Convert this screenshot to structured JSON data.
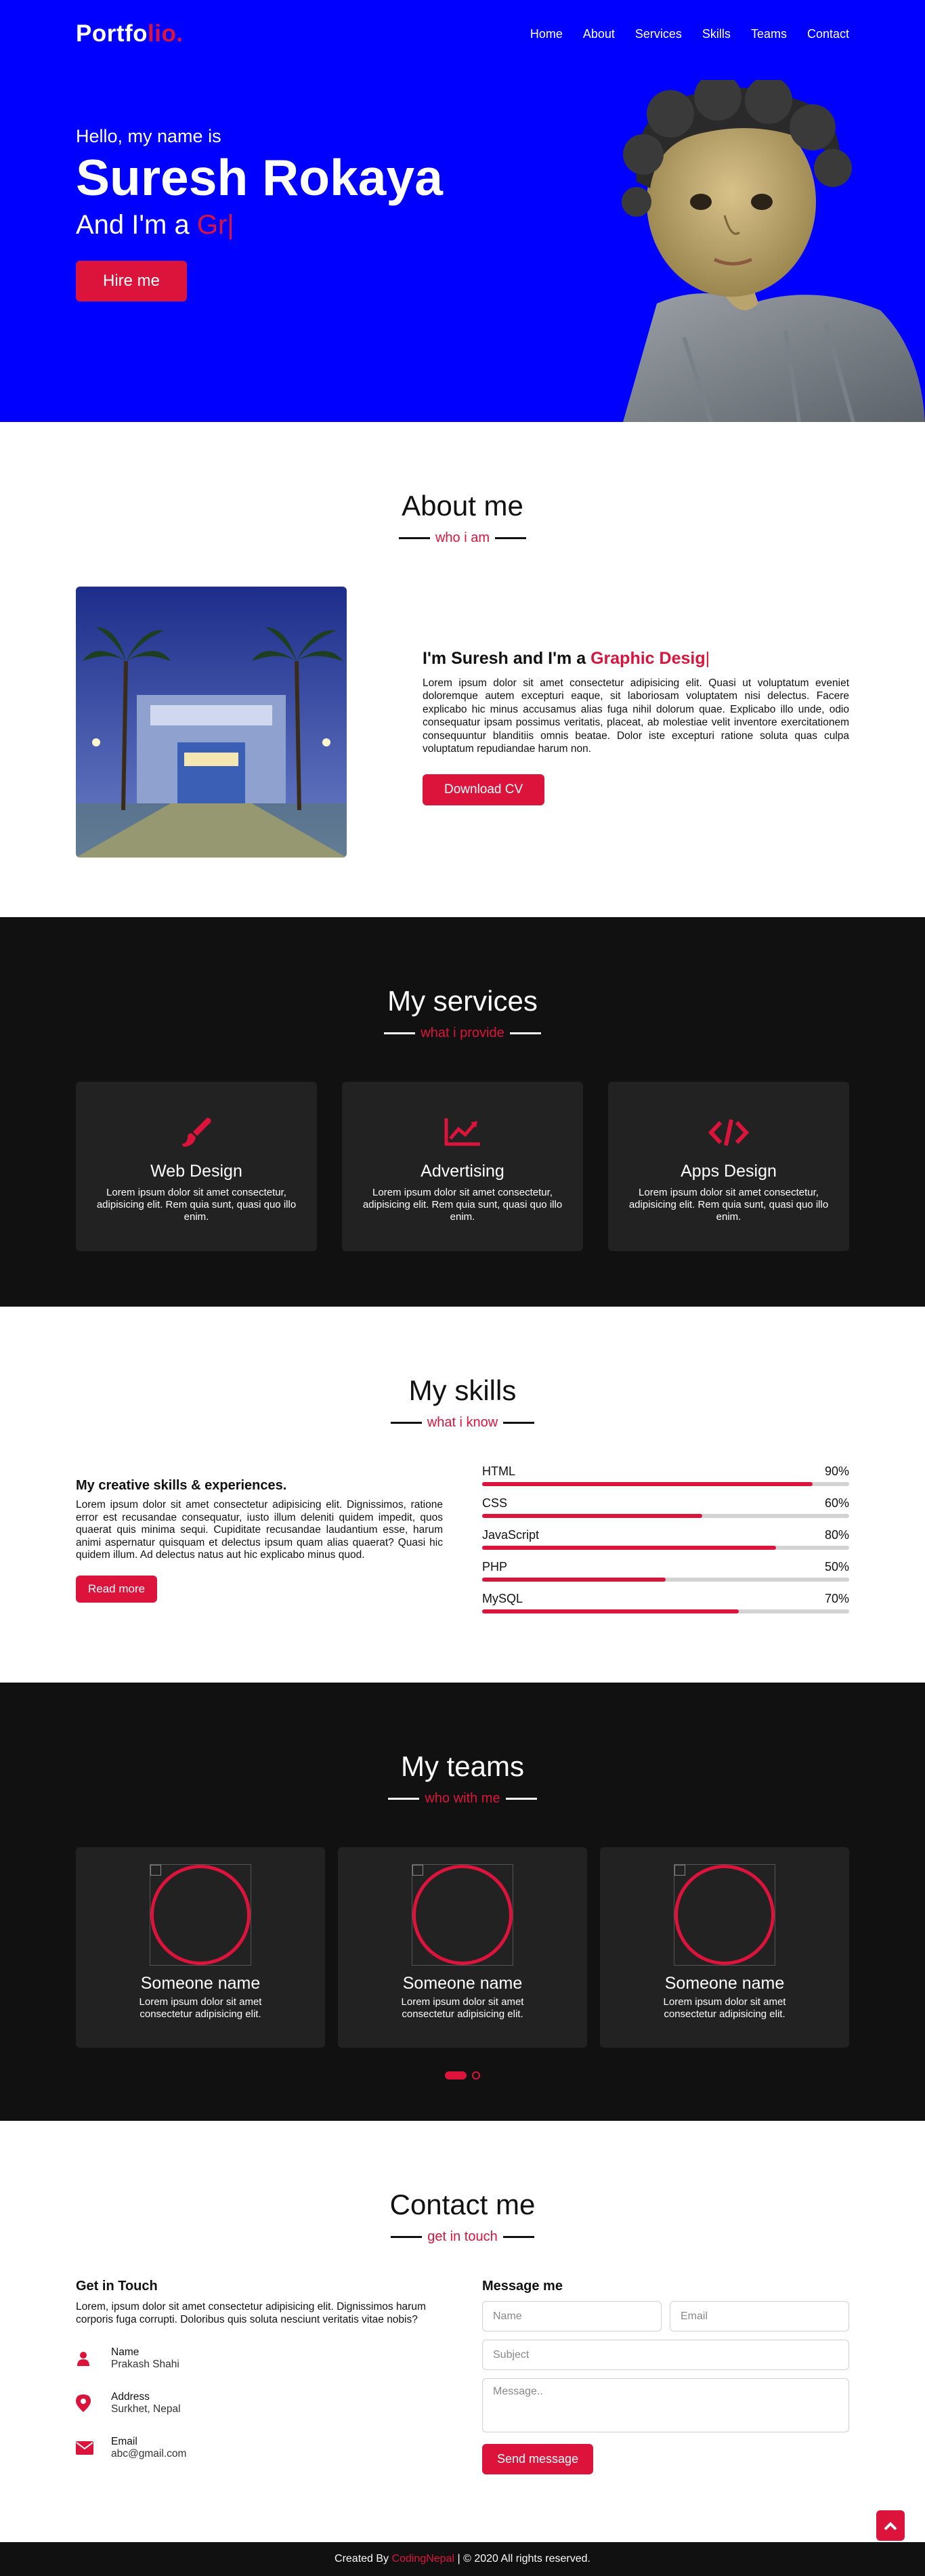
{
  "nav": {
    "logo_main": "Portfo",
    "logo_accent": "lio.",
    "items": [
      {
        "label": "Home"
      },
      {
        "label": "About"
      },
      {
        "label": "Services"
      },
      {
        "label": "Skills"
      },
      {
        "label": "Teams"
      },
      {
        "label": "Contact"
      }
    ]
  },
  "hero": {
    "greeting": "Hello, my name is",
    "name": "Suresh Rokaya",
    "role_prefix": "And I'm a",
    "role_typed": "Gr",
    "cursor": "|",
    "button": "Hire me"
  },
  "about": {
    "title": "About me",
    "subtitle": "who i am",
    "heading_prefix": "I'm Suresh and I'm a",
    "heading_typed": "Graphic Desig",
    "cursor": "|",
    "text": "Lorem ipsum dolor sit amet consectetur adipisicing elit. Quasi ut voluptatum eveniet doloremque autem excepturi eaque, sit laboriosam voluptatem nisi delectus. Facere explicabo hic minus accusamus alias fuga nihil dolorum quae. Explicabo illo unde, odio consequatur ipsam possimus veritatis, placeat, ab molestiae velit inventore exercitationem consequuntur blanditiis omnis beatae. Dolor iste excepturi ratione soluta quas culpa voluptatum repudiandae harum non.",
    "button": "Download CV"
  },
  "services": {
    "title": "My services",
    "subtitle": "what i provide",
    "cards": [
      {
        "icon": "paint-brush-icon",
        "title": "Web Design",
        "text": "Lorem ipsum dolor sit amet consectetur, adipisicing elit. Rem quia sunt, quasi quo illo enim."
      },
      {
        "icon": "chart-line-icon",
        "title": "Advertising",
        "text": "Lorem ipsum dolor sit amet consectetur, adipisicing elit. Rem quia sunt, quasi quo illo enim."
      },
      {
        "icon": "code-icon",
        "title": "Apps Design",
        "text": "Lorem ipsum dolor sit amet consectetur, adipisicing elit. Rem quia sunt, quasi quo illo enim."
      }
    ]
  },
  "skills": {
    "title": "My skills",
    "subtitle": "what i know",
    "heading": "My creative skills & experiences.",
    "text": "Lorem ipsum dolor sit amet consectetur adipisicing elit. Dignissimos, ratione error est recusandae consequatur, iusto illum deleniti quidem impedit, quos quaerat quis minima sequi. Cupiditate recusandae laudantium esse, harum animi aspernatur quisquam et delectus ipsum quam alias quaerat? Quasi hic quidem illum. Ad delectus natus aut hic explicabo minus quod.",
    "button": "Read more",
    "bars": [
      {
        "name": "HTML",
        "percent_label": "90%",
        "value": 0.9
      },
      {
        "name": "CSS",
        "percent_label": "60%",
        "value": 0.6
      },
      {
        "name": "JavaScript",
        "percent_label": "80%",
        "value": 0.8
      },
      {
        "name": "PHP",
        "percent_label": "50%",
        "value": 0.5
      },
      {
        "name": "MySQL",
        "percent_label": "70%",
        "value": 0.7
      }
    ]
  },
  "teams": {
    "title": "My teams",
    "subtitle": "who with me",
    "members": [
      {
        "name": "Someone name",
        "text": "Lorem ipsum dolor sit amet consectetur adipisicing elit."
      },
      {
        "name": "Someone name",
        "text": "Lorem ipsum dolor sit amet consectetur adipisicing elit."
      },
      {
        "name": "Someone name",
        "text": "Lorem ipsum dolor sit amet consectetur adipisicing elit."
      }
    ],
    "active_slide": 1,
    "slide_count": 2
  },
  "contact": {
    "title": "Contact me",
    "subtitle": "get in touch",
    "left_heading": "Get in Touch",
    "left_text": "Lorem, ipsum dolor sit amet consectetur adipisicing elit. Dignissimos harum corporis fuga corrupti. Doloribus quis soluta nesciunt veritatis vitae nobis?",
    "info": [
      {
        "icon": "user-icon",
        "label": "Name",
        "value": "Prakash Shahi"
      },
      {
        "icon": "map-marker-icon",
        "label": "Address",
        "value": "Surkhet, Nepal"
      },
      {
        "icon": "envelope-icon",
        "label": "Email",
        "value": "abc@gmail.com"
      }
    ],
    "right_heading": "Message me",
    "placeholders": {
      "name": "Name",
      "email": "Email",
      "subject": "Subject",
      "message": "Message.."
    },
    "button": "Send message"
  },
  "footer": {
    "prefix": "Created By",
    "author": "CodingNepal",
    "suffix": "| © 2020 All rights reserved."
  },
  "colors": {
    "hero_bg": "#0000fe",
    "accent": "#dc143c",
    "dark_bg": "#111111",
    "card_bg": "#222222"
  }
}
